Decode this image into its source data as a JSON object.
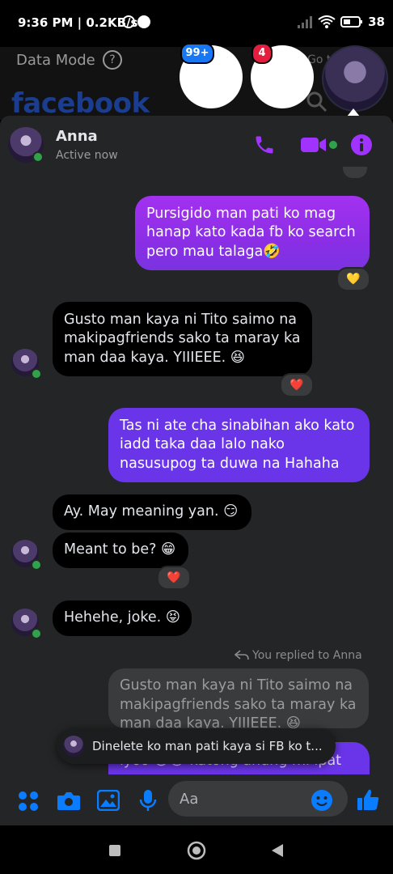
{
  "status_bar": {
    "time": "9:36 PM | 0.2KB/s",
    "battery": "38"
  },
  "background_app": {
    "data_mode": "Data Mode",
    "help": "?",
    "logo": "facebook",
    "goto": "Go t"
  },
  "chat_heads": [
    {
      "badge": "99+"
    },
    {
      "badge": "4"
    }
  ],
  "header": {
    "name": "Anna",
    "status": "Active now"
  },
  "messages": [
    {
      "from": "me",
      "text": "Pursigido man pati ko mag hanap kato kada fb ko search pero mau talaga🤣",
      "reaction": "💛"
    },
    {
      "from": "them",
      "text": "Gusto man kaya ni Tito saimo na makipagfriends sako ta maray ka man daa kaya. YIIIEEE. 😆",
      "reaction": "❤️"
    },
    {
      "from": "me",
      "text": "Tas ni ate cha sinabihan ako kato iadd taka daa lalo nako nasusupog ta duwa na Hahaha"
    },
    {
      "from": "them",
      "text": "Ay. May meaning yan. 😏"
    },
    {
      "from": "them",
      "text": "Meant to be? 😁",
      "reaction": "❤️"
    },
    {
      "from": "them",
      "text": "Hehehe, joke. 😝"
    }
  ],
  "reply": {
    "label": "You replied to Anna",
    "quoted": "Gusto man kaya ni Tito saimo na makipagfriends sako ta maray ka man daa kaya. YIIIEEE. 😆",
    "partial": "iyoo 😁😂 katong anung mi ipat"
  },
  "toast": {
    "text": "Dinelete ko man pati kaya si FB ko t..."
  },
  "composer": {
    "placeholder": "Aa"
  },
  "colors": {
    "accent": "#a033ff",
    "bubble_mine": "#8b2ee6",
    "online": "#31a24c"
  }
}
